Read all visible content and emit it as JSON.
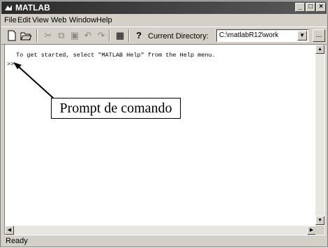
{
  "window": {
    "title": "MATLAB"
  },
  "menu": [
    "File",
    "Edit",
    "View",
    "Web",
    "Window",
    "Help"
  ],
  "toolbar": {
    "icons": [
      "new-file",
      "open-file",
      "cut",
      "copy",
      "paste",
      "undo",
      "redo",
      "simulink",
      "help"
    ],
    "current_directory_label": "Current Directory:",
    "current_directory_value": "C:\\matlabR12\\work",
    "browse_label": "..."
  },
  "command_window": {
    "intro_text": "To get started, select \"MATLAB Help\" from the Help menu.",
    "prompt": ">>"
  },
  "annotation": {
    "label": "Prompt de comando"
  },
  "status": {
    "text": "Ready"
  }
}
